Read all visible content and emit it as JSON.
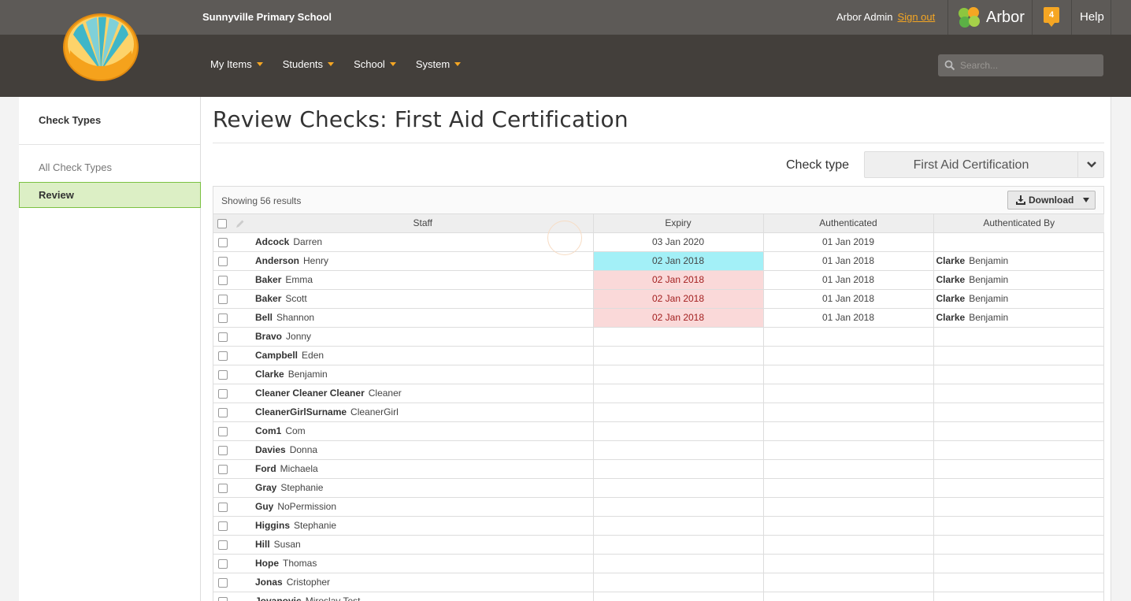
{
  "topbar": {
    "school_name": "Sunnyville Primary School",
    "user_name": "Arbor Admin",
    "sign_out": "Sign out",
    "brand": "Arbor",
    "notification_count": "4",
    "help": "Help"
  },
  "nav": {
    "items": [
      "My Items",
      "Students",
      "School",
      "System"
    ],
    "search_placeholder": "Search..."
  },
  "sidebar": {
    "title": "Check Types",
    "items": [
      "All Check Types",
      "Review"
    ],
    "active": "Review"
  },
  "main": {
    "title": "Review Checks: First Aid Certification",
    "check_type_label": "Check type",
    "check_type_value": "First Aid Certification",
    "showing": "Showing 56 results",
    "download": "Download",
    "columns": [
      "Staff",
      "Expiry",
      "Authenticated",
      "Authenticated By"
    ]
  },
  "rows": [
    {
      "last": "Adcock",
      "first": "Darren",
      "expiry": "03 Jan 2020",
      "expiry_status": "ok",
      "authenticated": "01 Jan 2019",
      "by_last": "",
      "by_first": ""
    },
    {
      "last": "Anderson",
      "first": "Henry",
      "expiry": "02 Jan 2018",
      "expiry_status": "selected",
      "authenticated": "01 Jan 2018",
      "by_last": "Clarke",
      "by_first": "Benjamin"
    },
    {
      "last": "Baker",
      "first": "Emma",
      "expiry": "02 Jan 2018",
      "expiry_status": "expired",
      "authenticated": "01 Jan 2018",
      "by_last": "Clarke",
      "by_first": "Benjamin"
    },
    {
      "last": "Baker",
      "first": "Scott",
      "expiry": "02 Jan 2018",
      "expiry_status": "expired",
      "authenticated": "01 Jan 2018",
      "by_last": "Clarke",
      "by_first": "Benjamin"
    },
    {
      "last": "Bell",
      "first": "Shannon",
      "expiry": "02 Jan 2018",
      "expiry_status": "expired",
      "authenticated": "01 Jan 2018",
      "by_last": "Clarke",
      "by_first": "Benjamin"
    },
    {
      "last": "Bravo",
      "first": "Jonny",
      "expiry": "",
      "expiry_status": "",
      "authenticated": "",
      "by_last": "",
      "by_first": ""
    },
    {
      "last": "Campbell",
      "first": "Eden",
      "expiry": "",
      "expiry_status": "",
      "authenticated": "",
      "by_last": "",
      "by_first": ""
    },
    {
      "last": "Clarke",
      "first": "Benjamin",
      "expiry": "",
      "expiry_status": "",
      "authenticated": "",
      "by_last": "",
      "by_first": ""
    },
    {
      "last": "Cleaner Cleaner Cleaner",
      "first": "Cleaner",
      "expiry": "",
      "expiry_status": "",
      "authenticated": "",
      "by_last": "",
      "by_first": ""
    },
    {
      "last": "CleanerGirlSurname",
      "first": "CleanerGirl",
      "expiry": "",
      "expiry_status": "",
      "authenticated": "",
      "by_last": "",
      "by_first": ""
    },
    {
      "last": "Com1",
      "first": "Com",
      "expiry": "",
      "expiry_status": "",
      "authenticated": "",
      "by_last": "",
      "by_first": ""
    },
    {
      "last": "Davies",
      "first": "Donna",
      "expiry": "",
      "expiry_status": "",
      "authenticated": "",
      "by_last": "",
      "by_first": ""
    },
    {
      "last": "Ford",
      "first": "Michaela",
      "expiry": "",
      "expiry_status": "",
      "authenticated": "",
      "by_last": "",
      "by_first": ""
    },
    {
      "last": "Gray",
      "first": "Stephanie",
      "expiry": "",
      "expiry_status": "",
      "authenticated": "",
      "by_last": "",
      "by_first": ""
    },
    {
      "last": "Guy",
      "first": "NoPermission",
      "expiry": "",
      "expiry_status": "",
      "authenticated": "",
      "by_last": "",
      "by_first": ""
    },
    {
      "last": "Higgins",
      "first": "Stephanie",
      "expiry": "",
      "expiry_status": "",
      "authenticated": "",
      "by_last": "",
      "by_first": ""
    },
    {
      "last": "Hill",
      "first": "Susan",
      "expiry": "",
      "expiry_status": "",
      "authenticated": "",
      "by_last": "",
      "by_first": ""
    },
    {
      "last": "Hope",
      "first": "Thomas",
      "expiry": "",
      "expiry_status": "",
      "authenticated": "",
      "by_last": "",
      "by_first": ""
    },
    {
      "last": "Jonas",
      "first": "Cristopher",
      "expiry": "",
      "expiry_status": "",
      "authenticated": "",
      "by_last": "",
      "by_first": ""
    },
    {
      "last": "Jovanovic",
      "first": "Miroslav Test",
      "expiry": "",
      "expiry_status": "",
      "authenticated": "",
      "by_last": "",
      "by_first": ""
    }
  ],
  "colors": {
    "accent": "#f5a623",
    "active_green": "#7bc142",
    "selected_cell": "#a3f0f7",
    "expired_cell": "#fad9d9"
  }
}
